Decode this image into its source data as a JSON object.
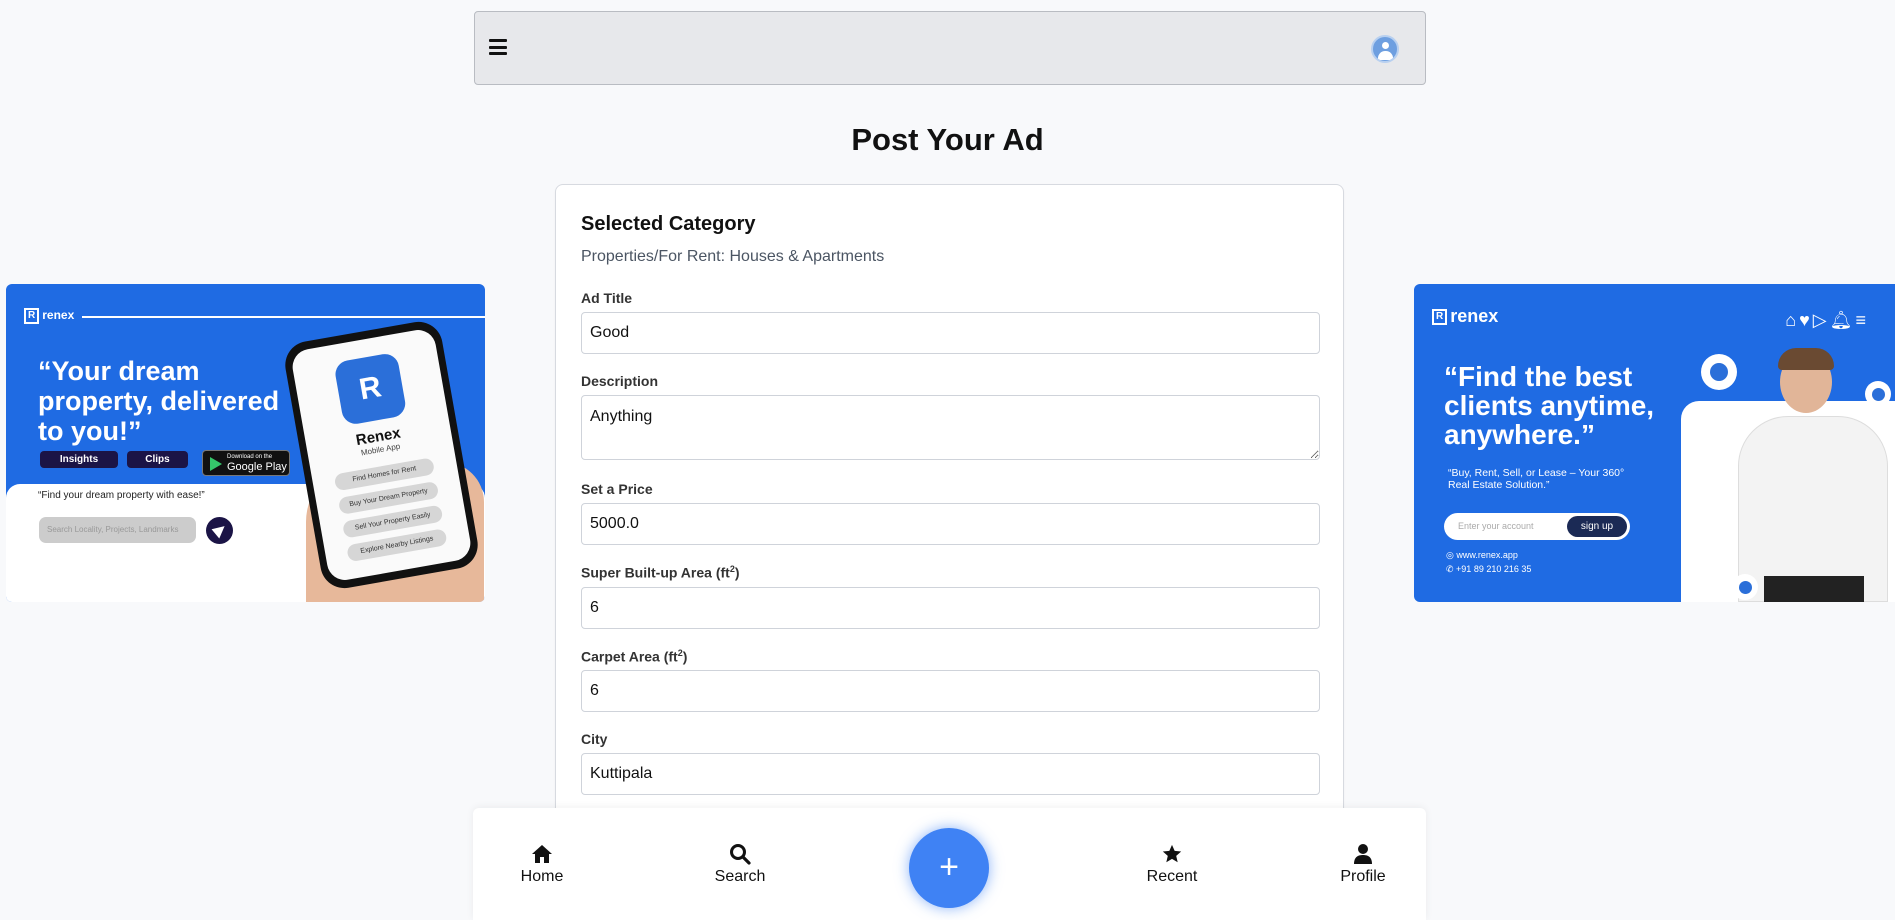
{
  "header": {
    "menu_icon": "hamburger-icon",
    "profile_icon": "user-circle-icon"
  },
  "page": {
    "title": "Post Your Ad"
  },
  "form": {
    "selected_category_title": "Selected Category",
    "selected_category_value": "Properties/For Rent: Houses & Apartments",
    "fields": {
      "ad_title": {
        "label": "Ad Title",
        "value": "Good"
      },
      "description": {
        "label": "Description",
        "value": "Anything"
      },
      "price": {
        "label": "Set a Price",
        "value": "5000.0"
      },
      "super_area": {
        "label": "Super Built-up Area (ft",
        "sup": "2",
        "label_end": ")",
        "value": "6"
      },
      "carpet_area": {
        "label": "Carpet Area (ft",
        "sup": "2",
        "label_end": ")",
        "value": "6"
      },
      "city": {
        "label": "City",
        "value": "Kuttipala"
      }
    }
  },
  "ad_left": {
    "brand": "renex",
    "headline": "“Your dream property, delivered to you!”",
    "pill_insights": "Insights",
    "pill_clips": "Clips",
    "gplay_small": "Download on the",
    "gplay_big": "Google Play",
    "tagline": "“Find your dream property with ease!”",
    "search_placeholder": "Search Locality, Projects, Landmarks",
    "phone_app_name": "Renex",
    "phone_app_sub": "Mobile App",
    "phone_menu": [
      "Find Homes for Rent",
      "Buy Your Dream Property",
      "Sell Your Property Easily",
      "Explore Nearby Listings"
    ]
  },
  "ad_right": {
    "brand": "renex",
    "headline": "“Find the best clients anytime, anywhere.”",
    "sub": "“Buy, Rent, Sell, or Lease – Your 360° Real Estate Solution.”",
    "signup_placeholder": "Enter your account",
    "signup_button": "sign up",
    "website": "www.renex.app",
    "phone": "+91 89 210 216 35"
  },
  "bottom_nav": {
    "home": "Home",
    "search": "Search",
    "add": "+",
    "recent": "Recent",
    "profile": "Profile"
  },
  "colors": {
    "accent": "#3f82f4",
    "ad_blue": "#1f6be3"
  }
}
